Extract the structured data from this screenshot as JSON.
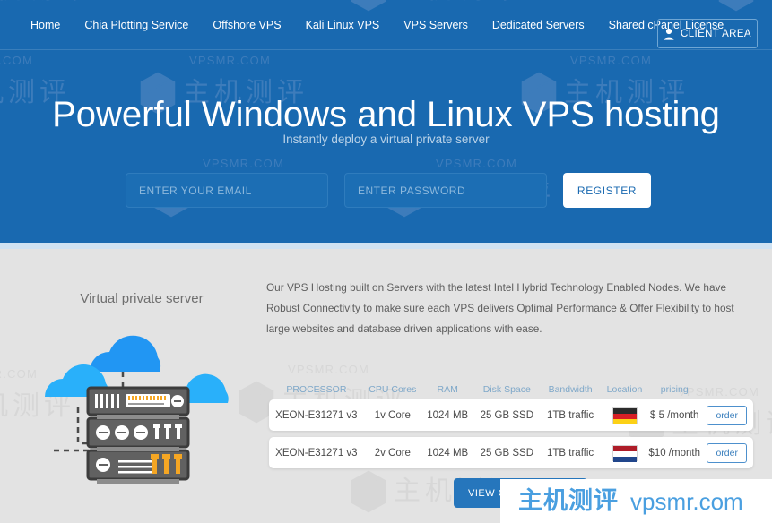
{
  "nav": {
    "items": [
      {
        "label": "Home"
      },
      {
        "label": "Chia Plotting Service"
      },
      {
        "label": "Offshore VPS"
      },
      {
        "label": "Kali Linux VPS"
      },
      {
        "label": "VPS Servers"
      },
      {
        "label": "Dedicated Servers"
      },
      {
        "label": "Shared cPanel License"
      }
    ],
    "client_area_label": "CLIENT AREA",
    "client_area_icon": "user-icon"
  },
  "hero": {
    "title": "Powerful Windows and Linux VPS hosting",
    "subtitle": "Instantly deploy a virtual private server",
    "email_placeholder": "ENTER YOUR EMAIL",
    "email_value": "",
    "password_placeholder": "ENTER PASSWORD",
    "password_value": "",
    "register_label": "REGISTER",
    "bg_color": "#1969b0"
  },
  "main": {
    "illustration_title": "Virtual private server",
    "description": "Our VPS Hosting built on Servers with the latest Intel Hybrid Technology Enabled Nodes. We have Robust Connectivity to make sure each VPS delivers Optimal Performance & Offer Flexibility to host large websites and database driven applications with ease.",
    "view_other_label": "VIEW OTHER PLANS",
    "bg_color": "#e3e3e3"
  },
  "pricing_table": {
    "headers": {
      "processor": "PROCESSOR",
      "cpu": "CPU Cores",
      "ram": "RAM",
      "disk": "Disk Space",
      "bandwidth": "Bandwidth",
      "location": "Location",
      "pricing": "pricing"
    },
    "rows": [
      {
        "processor": "XEON-E31271 v3",
        "cpu": "1v Core",
        "ram": "1024 MB",
        "disk": "25 GB SSD",
        "bandwidth": "1TB traffic",
        "location_flag": "germany-flag",
        "price": "$ 5 /month",
        "order_label": "order"
      },
      {
        "processor": "XEON-E31271 v3",
        "cpu": "2v Core",
        "ram": "1024 MB",
        "disk": "25 GB SSD",
        "bandwidth": "1TB traffic",
        "location_flag": "netherlands-flag",
        "price": "$10 /month",
        "order_label": "order"
      }
    ]
  },
  "watermark": {
    "domain_text": "VPSMR.COM",
    "cn_text": "主机测评",
    "logo_icon": "hexagon-chart-logo-icon"
  },
  "brand_overlay": {
    "cn_text": "主机测评",
    "domain_text": "vpsmr.com",
    "color": "#4a9fe0"
  }
}
